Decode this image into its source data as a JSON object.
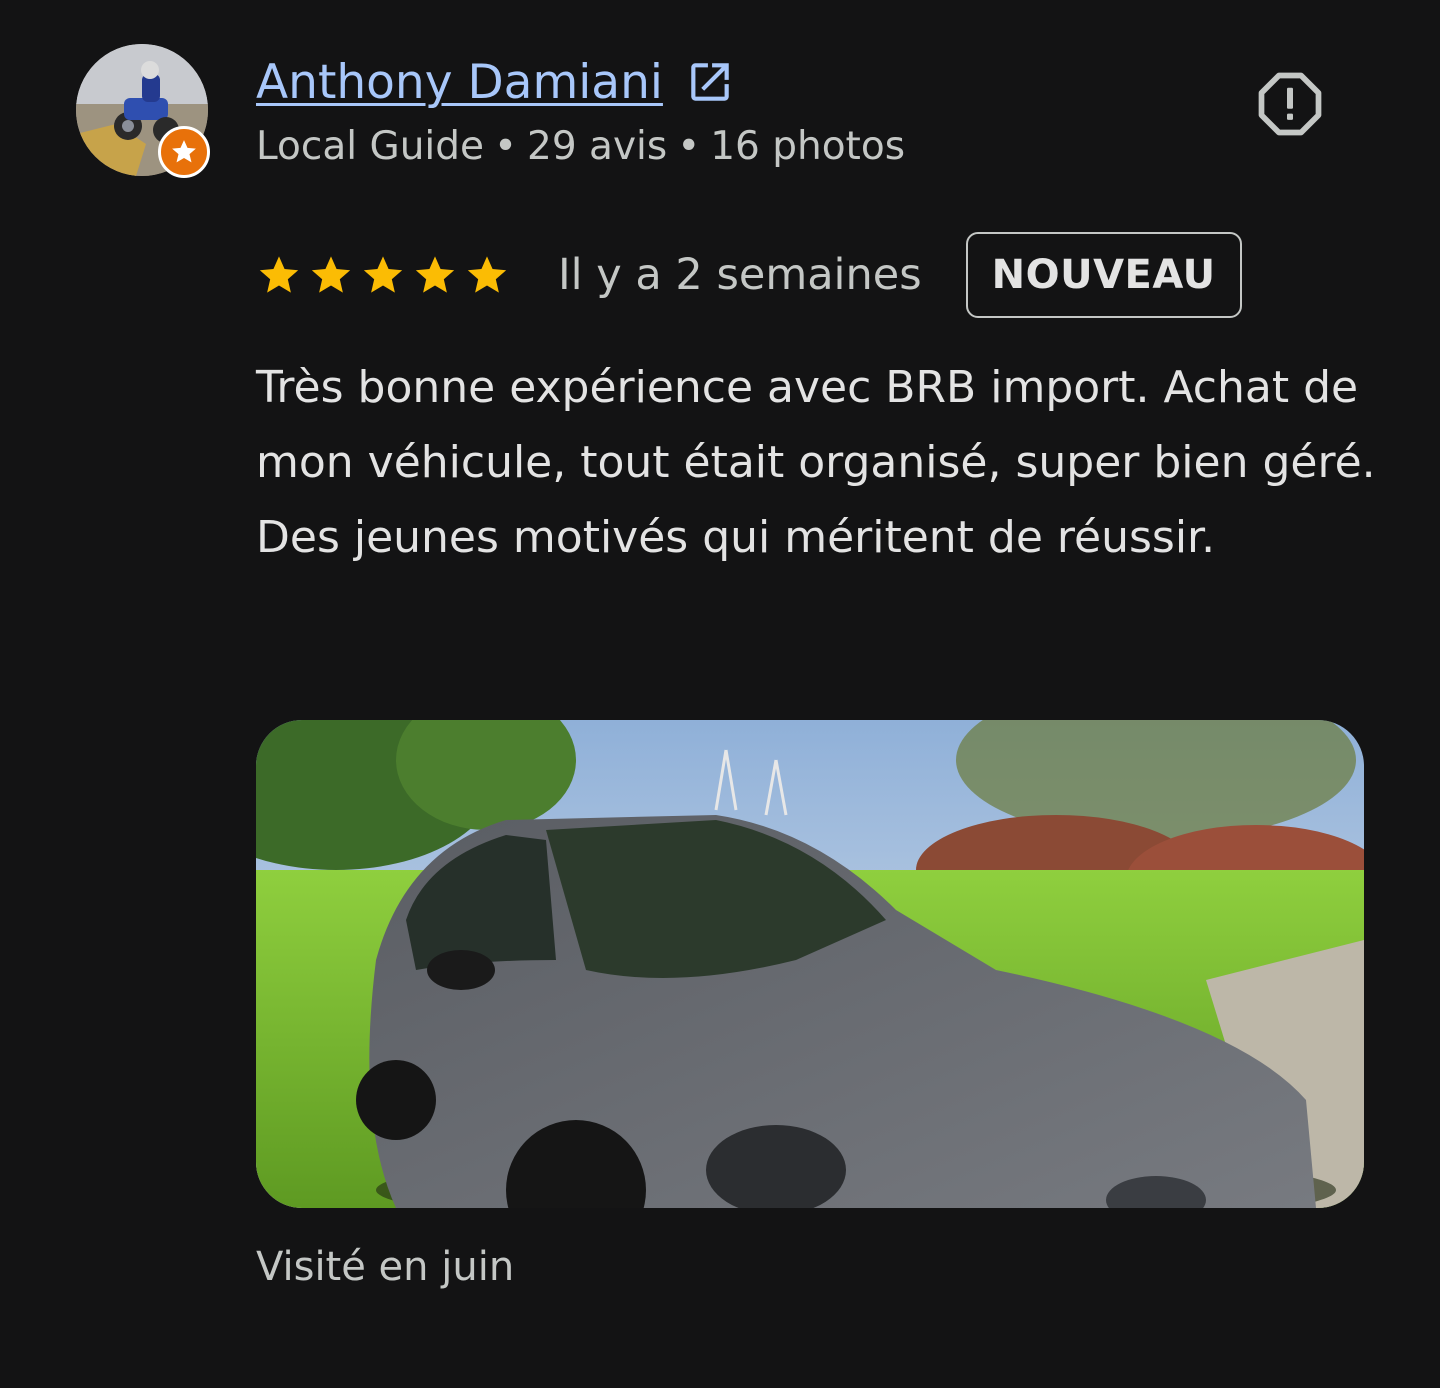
{
  "reviewer": {
    "name": "Anthony Damiani",
    "meta_guide": "Local Guide",
    "meta_reviews": "29 avis",
    "meta_photos": "16 photos",
    "separator": "•",
    "badge_color": "#e8710a",
    "link_color": "#a8c7fa"
  },
  "review": {
    "rating": 5,
    "max_rating": 5,
    "star_color": "#fbbc04",
    "time_ago": "Il y a 2 semaines",
    "badge": "NOUVEAU",
    "text": "Très bonne expérience avec BRB import. Achat de mon véhicule, tout était organisé, super bien géré. Des jeunes motivés qui méritent de réussir.",
    "visited": "Visité en juin"
  },
  "icons": {
    "external_link": "open-in-new-icon",
    "report": "report-icon",
    "star": "star-icon",
    "local_guide_badge": "local-guide-star-icon"
  }
}
